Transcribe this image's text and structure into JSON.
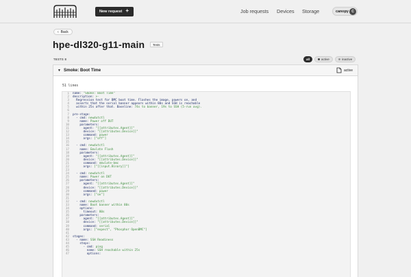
{
  "header": {
    "new_request": "New request",
    "nav": [
      "Job requests",
      "Devices",
      "Storage"
    ],
    "user": "canopy",
    "avatar_initial": "C"
  },
  "page": {
    "back": "Back",
    "title": "hpe-dl320-g11-main",
    "tag": "Tests",
    "tests_label": "TESTS 8",
    "filters": [
      "all",
      "active",
      "inactive"
    ]
  },
  "card": {
    "title": "Smoke: Boot Time",
    "state": "active",
    "lines_count": "51 lines",
    "code": [
      [
        "name: ",
        "\"Smoke: Boot Time\""
      ],
      [
        "description: ",
        ">-"
      ],
      [
        "  Regression test for BMC boot time. Flashes the image, powers on, and",
        ""
      ],
      [
        "  asserts that the serial banner appears within 80s and SSH is reachable",
        ""
      ],
      [
        "  within 25s after that. Baseline: ",
        "74s to banner, 19s to SSH (5-run avg)."
      ],
      [
        "",
        ""
      ],
      [
        "pre-stage:",
        ""
      ],
      [
        "  - cmd: ",
        "newdutctl"
      ],
      [
        "    name: ",
        "Power off DUT"
      ],
      [
        "    parameters:",
        ""
      ],
      [
        "      agent: ",
        "\"[[attributes.Agent]]\""
      ],
      [
        "      device: ",
        "\"[[attributes.Device]]\""
      ],
      [
        "      command: ",
        "power"
      ],
      [
        "      args: ",
        "[\"off\"]"
      ],
      [
        "",
        ""
      ],
      [
        "  - cmd: ",
        "newdutctl"
      ],
      [
        "    name: ",
        "Emulate Flash"
      ],
      [
        "    parameters:",
        ""
      ],
      [
        "      agent: ",
        "\"[[attributes.Agent]]\""
      ],
      [
        "      device: ",
        "\"[[attributes.Device]]\""
      ],
      [
        "      command: ",
        "emulate-bmc"
      ],
      [
        "      args: ",
        "[\"[[input.Binary]]\"]"
      ],
      [
        "",
        ""
      ],
      [
        "  - cmd: ",
        "newdutctl"
      ],
      [
        "    name: ",
        "Power on DUT"
      ],
      [
        "    parameters:",
        ""
      ],
      [
        "      agent: ",
        "\"[[attributes.Agent]]\""
      ],
      [
        "      device: ",
        "\"[[attributes.Device]]\""
      ],
      [
        "      command: ",
        "power"
      ],
      [
        "      args: ",
        "[\"on\"]"
      ],
      [
        "",
        ""
      ],
      [
        "  - cmd: ",
        "newdutctl"
      ],
      [
        "    name: ",
        "Boot banner within 80s"
      ],
      [
        "    options:",
        ""
      ],
      [
        "      timeout: ",
        "80s"
      ],
      [
        "    parameters:",
        ""
      ],
      [
        "      agent: ",
        "\"[[attributes.Agent]]\""
      ],
      [
        "      device: ",
        "\"[[attributes.Device]]\""
      ],
      [
        "      command: ",
        "serial"
      ],
      [
        "      args: ",
        "[\"expect\", \"Phosphor OpenBMC\"]"
      ],
      [
        "",
        ""
      ],
      [
        "stages:",
        ""
      ],
      [
        "  - name: ",
        "SSH Readiness"
      ],
      [
        "    steps:",
        ""
      ],
      [
        "      - cmd: ",
        "ping"
      ],
      [
        "        name: ",
        "SSH reachable within 25s"
      ],
      [
        "        options:",
        ""
      ]
    ]
  }
}
